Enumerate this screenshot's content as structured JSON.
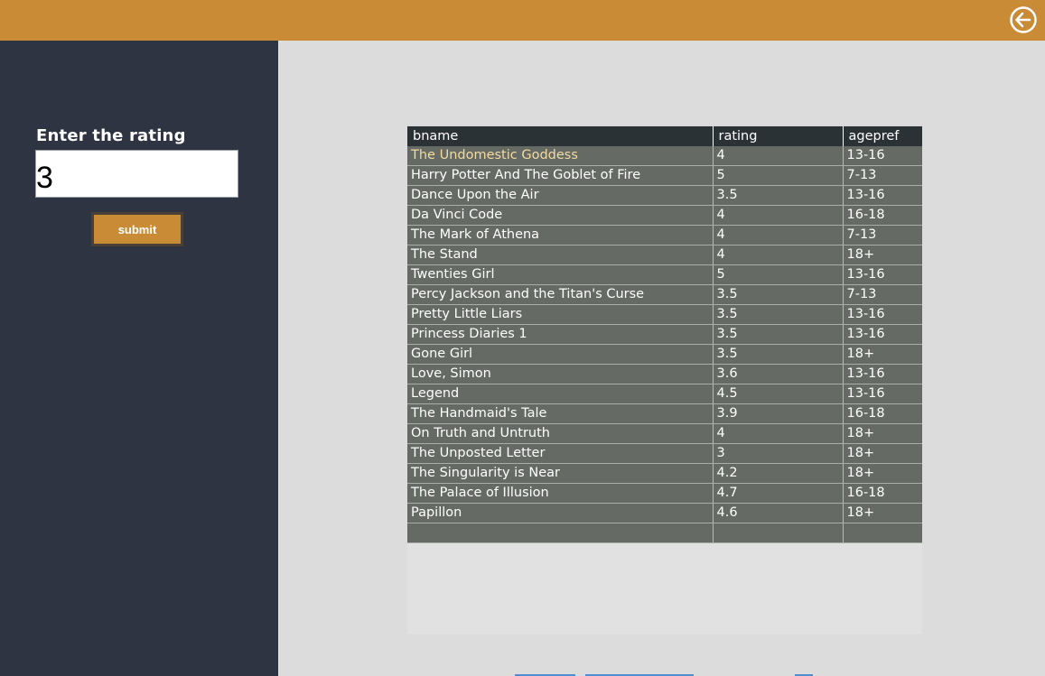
{
  "header": {
    "back_icon": "back-arrow-circle-icon",
    "accent_color": "#c98b35"
  },
  "sidebar": {
    "rating_label": "Enter the rating",
    "rating_value": "3",
    "submit_label": "submit",
    "background_color": "#2e3441"
  },
  "table": {
    "columns": [
      "bname",
      "rating",
      "agepref"
    ],
    "rows": [
      [
        "The Undomestic Goddess",
        "4",
        "13-16"
      ],
      [
        "Harry Potter And The Goblet of Fire",
        "5",
        "7-13"
      ],
      [
        "Dance Upon the Air",
        "3.5",
        "13-16"
      ],
      [
        "Da Vinci Code",
        "4",
        "16-18"
      ],
      [
        "The Mark of Athena",
        "4",
        "7-13"
      ],
      [
        "The Stand",
        "4",
        "18+"
      ],
      [
        "Twenties Girl",
        "5",
        "13-16"
      ],
      [
        "Percy Jackson and the Titan's Curse",
        "3.5",
        "7-13"
      ],
      [
        "Pretty Little Liars",
        "3.5",
        "13-16"
      ],
      [
        "Princess Diaries 1",
        "3.5",
        "13-16"
      ],
      [
        "Gone Girl",
        "3.5",
        "18+"
      ],
      [
        "Love, Simon",
        "3.6",
        "13-16"
      ],
      [
        "Legend",
        "4.5",
        "13-16"
      ],
      [
        "The Handmaid's Tale",
        "3.9",
        "16-18"
      ],
      [
        "On Truth and Untruth",
        "4",
        "18+"
      ],
      [
        "The Unposted Letter",
        "3",
        "18+"
      ],
      [
        "The Singularity is Near",
        "4.2",
        "18+"
      ],
      [
        "The Palace of Illusion",
        "4.7",
        "16-18"
      ],
      [
        "Papillon",
        "4.6",
        "18+"
      ]
    ],
    "row_color": "#656a64",
    "header_color": "#2b3236",
    "selected_text_color": "#f3dba0"
  }
}
